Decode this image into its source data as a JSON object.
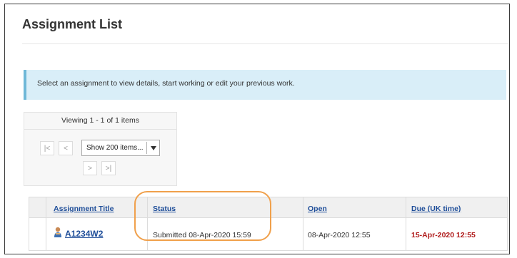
{
  "page": {
    "title": "Assignment List",
    "info_message": "Select an assignment to view details, start working or edit your previous work."
  },
  "pager": {
    "viewing_text": "Viewing 1 - 1 of 1 items",
    "first_label": "|<",
    "prev_label": "<",
    "next_label": ">",
    "last_label": ">|",
    "page_size_selected": "Show 200 items..."
  },
  "table": {
    "headers": {
      "title": "Assignment Title",
      "status": "Status",
      "open": "Open",
      "due": "Due (UK time)"
    },
    "rows": [
      {
        "title": "A1234W2",
        "status": "Submitted 08-Apr-2020 15:59",
        "open": "08-Apr-2020 12:55",
        "due": "15-Apr-2020 12:55"
      }
    ]
  },
  "colors": {
    "link": "#1f4e99",
    "due_text": "#b01c1c",
    "info_background": "#d9eef8",
    "highlight_outline": "#f0a04b"
  },
  "icons": {
    "assignment_owner": "user-icon"
  }
}
